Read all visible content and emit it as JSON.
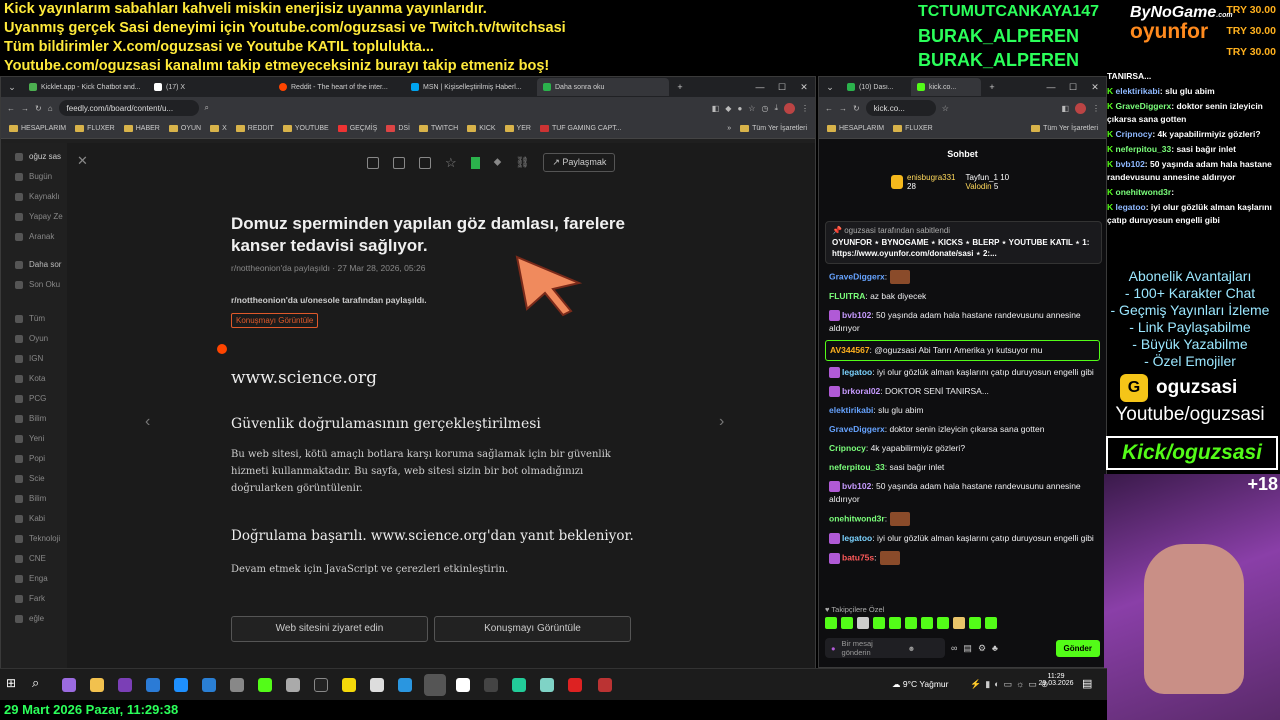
{
  "overlay": {
    "ticker": [
      "Kick yayınlarım sabahları kahveli miskin enerjisiz uyanma yayınlarıdır.",
      "Uyanmış gerçek Sasi deneyimi için Youtube.com/oguzsasi ve Twitch.tv/twitchsasi",
      "Tüm bildirimler X.com/oguzsasi ve Youtube KATIL toplulukta...",
      "Youtube.com/oguzsasi kanalımı takip etmeyeceksiniz burayı takip etmeniz boş!"
    ],
    "names": [
      "TCTUMUTCANKAYA147",
      "BURAK_ALPEREN",
      "BURAK_ALPEREN"
    ],
    "logo_top": "ByNoGame",
    "logo_top_small": ".com",
    "logo_bottom": "oyunfor",
    "donations": [
      "TRY 30.00",
      "TRY 30.00",
      "TRY 30.00"
    ],
    "perks": [
      "Abonelik Avantajları",
      "- 100+ Karakter Chat",
      "- Geçmiş Yayınları İzleme",
      "- Link Paylaşabilme",
      "- Büyük Yazabilme",
      "- Özel Emojiler"
    ],
    "channel_name": "oguzsasi",
    "channel_youtube": "Youtube/oguzsasi",
    "channel_kick": "Kick/oguzsasi",
    "webcam_count": "+18",
    "datetime": "29 Mart 2026 Pazar, 11:29:38"
  },
  "overlay_chat": [
    {
      "user": "",
      "text": "TANIRSA..."
    },
    {
      "user": "elektirikabi",
      "text": ": slu glu abim"
    },
    {
      "user": "GraveDiggerx",
      "text": ": doktor senin izleyicin çıkarsa sana gotten"
    },
    {
      "user": "Cripnocy",
      "text": ": 4k yapabilirmiyiz gözleri?"
    },
    {
      "user": "neferpitou_33",
      "text": ": sasi bağır inlet"
    },
    {
      "user": "bvb102",
      "text": ": 50 yaşında adam hala hastane randevusunu annesine aldırıyor"
    },
    {
      "user": "onehitwond3r",
      "text": ":"
    },
    {
      "user": "legatoo",
      "text": ": iyi olur gözlük alman kaşlarını çatıp duruyosun engelli gibi"
    }
  ],
  "left_browser": {
    "tabs": [
      "Kicklet.app - Kick Chatbot and...",
      "(17) X",
      "Reddit - The heart of the inter...",
      "MSN | Kişiselleştirilmiş Haberl...",
      "Daha sonra oku"
    ],
    "url": "feedly.com/i/board/content/u...",
    "bookmarks": [
      "HESAPLARIM",
      "FLUXER",
      "HABER",
      "OYUN",
      "X",
      "REDDIT",
      "YOUTUBE",
      "GEÇMİŞ",
      "DSİ",
      "TWITCH",
      "KICK",
      "YER",
      "TUF GAMING CAPT...",
      "Tüm Yer İşaretleri"
    ],
    "feed_sidebar": [
      "oğuz sas",
      "Bugün",
      "Kaynaklı",
      "Yapay Ze",
      "Aranak",
      "Daha sor",
      "Son Oku",
      "Tüm",
      "Oyun",
      "IGN",
      "Kota",
      "PCG",
      "Bilim",
      "Yeni",
      "Popi",
      "Scie",
      "Bilim",
      "Kabi",
      "Teknoloji",
      "CNE",
      "Enga",
      "Fark",
      "eğle"
    ],
    "share_label": "Paylaşmak",
    "article": {
      "title": "Domuz sperminden yapılan göz damlası, farelere kanser tedavisi sağlıyor.",
      "meta": "r/nottheonion'da paylaşıldı · 27 Mar 28, 2026, 05:26",
      "shared_by": "r/nottheonion'da u/onesole tarafından paylaşıldı.",
      "conversation_tag": "Konuşmayı Görüntüle",
      "site": "www.science.org",
      "heading": "Güvenlik doğrulamasının gerçekleştirilmesi",
      "para": "Bu web sitesi, kötü amaçlı botlara karşı koruma sağlamak için bir güvenlik hizmeti kullanmaktadır. Bu sayfa, web sitesi sizin bir bot olmadığınızı doğrularken görüntülenir.",
      "success": "Doğrulama başarılı. www.science.org'dan yanıt bekleniyor.",
      "js_note": "Devam etmek için JavaScript ve çerezleri etkinleştirin.",
      "btn_visit": "Web sitesini ziyaret edin",
      "btn_conv": "Konuşmayı Görüntüle"
    }
  },
  "right_browser": {
    "tabs": [
      "(10) Dası...",
      "kick.co..."
    ],
    "url": "kick.co...",
    "bookmarks": [
      "HESAPLARIM",
      "FLUXER",
      "Tüm Yer İşaretleri"
    ],
    "chat_title": "Sohbet",
    "top_gifters": [
      {
        "name": "enisbugra331",
        "count": "28"
      },
      {
        "name": "Tayfun_1",
        "count": "10"
      },
      {
        "name": "Valodin",
        "count": "5"
      }
    ],
    "pinned_by": "oguzsasi tarafından sabitlendi",
    "pinned_text": "OYUNFOR ⋆ BYNOGAME ⋆ KICKS ⋆ BLERP ⋆ YOUTUBE KATIL ⋆ 1: https://www.oyunfor.com/donate/sasi ⋆ 2:...",
    "followers_only": "Takipçilere Özel",
    "input_placeholder": "Bir mesaj gönderin",
    "send_label": "Gönder"
  },
  "chat_messages": [
    {
      "user": "GraveDiggerx",
      "color": "#66a3ff",
      "text": ":",
      "emote": true
    },
    {
      "user": "FLUITRA",
      "color": "#7bff7b",
      "text": ": az bak diyecek"
    },
    {
      "user": "bvb102",
      "color": "#c79bff",
      "text": ": 50 yaşında adam hala hastane randevusunu annesine aldırıyor",
      "badge": true
    },
    {
      "user": "AV344567",
      "color": "#ffb11e",
      "text": ": @oguzsasi Abi Tanrı Amerika yı kutsuyor mu",
      "highlight": true
    },
    {
      "user": "legatoo",
      "color": "#7bd3ff",
      "text": ": iyi olur gözlük alman kaşlarını çatıp duruyosun engelli gibi",
      "badge": true
    },
    {
      "user": "brkoral02",
      "color": "#c79bff",
      "text": ": DOKTOR SENİ TANIRSA...",
      "badge": true
    },
    {
      "user": "elektirikabi",
      "color": "#66a3ff",
      "text": ": slu glu abim"
    },
    {
      "user": "GraveDiggerx",
      "color": "#66a3ff",
      "text": ": doktor senin izleyicin çıkarsa sana gotten"
    },
    {
      "user": "Cripnocy",
      "color": "#7bff7b",
      "text": ": 4k yapabilirmiyiz gözleri?"
    },
    {
      "user": "neferpitou_33",
      "color": "#7bff7b",
      "text": ": sasi bağır inlet"
    },
    {
      "user": "bvb102",
      "color": "#c79bff",
      "text": ": 50 yaşında adam hala hastane randevusunu annesine aldırıyor",
      "badge": true
    },
    {
      "user": "onehitwond3r",
      "color": "#7bff7b",
      "text": ":",
      "emote": true
    },
    {
      "user": "legatoo",
      "color": "#7bd3ff",
      "text": ": iyi olur gözlük alman kaşlarını çatıp duruyosun engelli gibi",
      "badge": true
    },
    {
      "user": "batu75s",
      "color": "#ff5a5a",
      "text": ":",
      "badge": true,
      "emote": true
    }
  ],
  "taskbar": {
    "weather": "9°C  Yağmur",
    "time": "11:29",
    "date": "29.03.2026"
  }
}
